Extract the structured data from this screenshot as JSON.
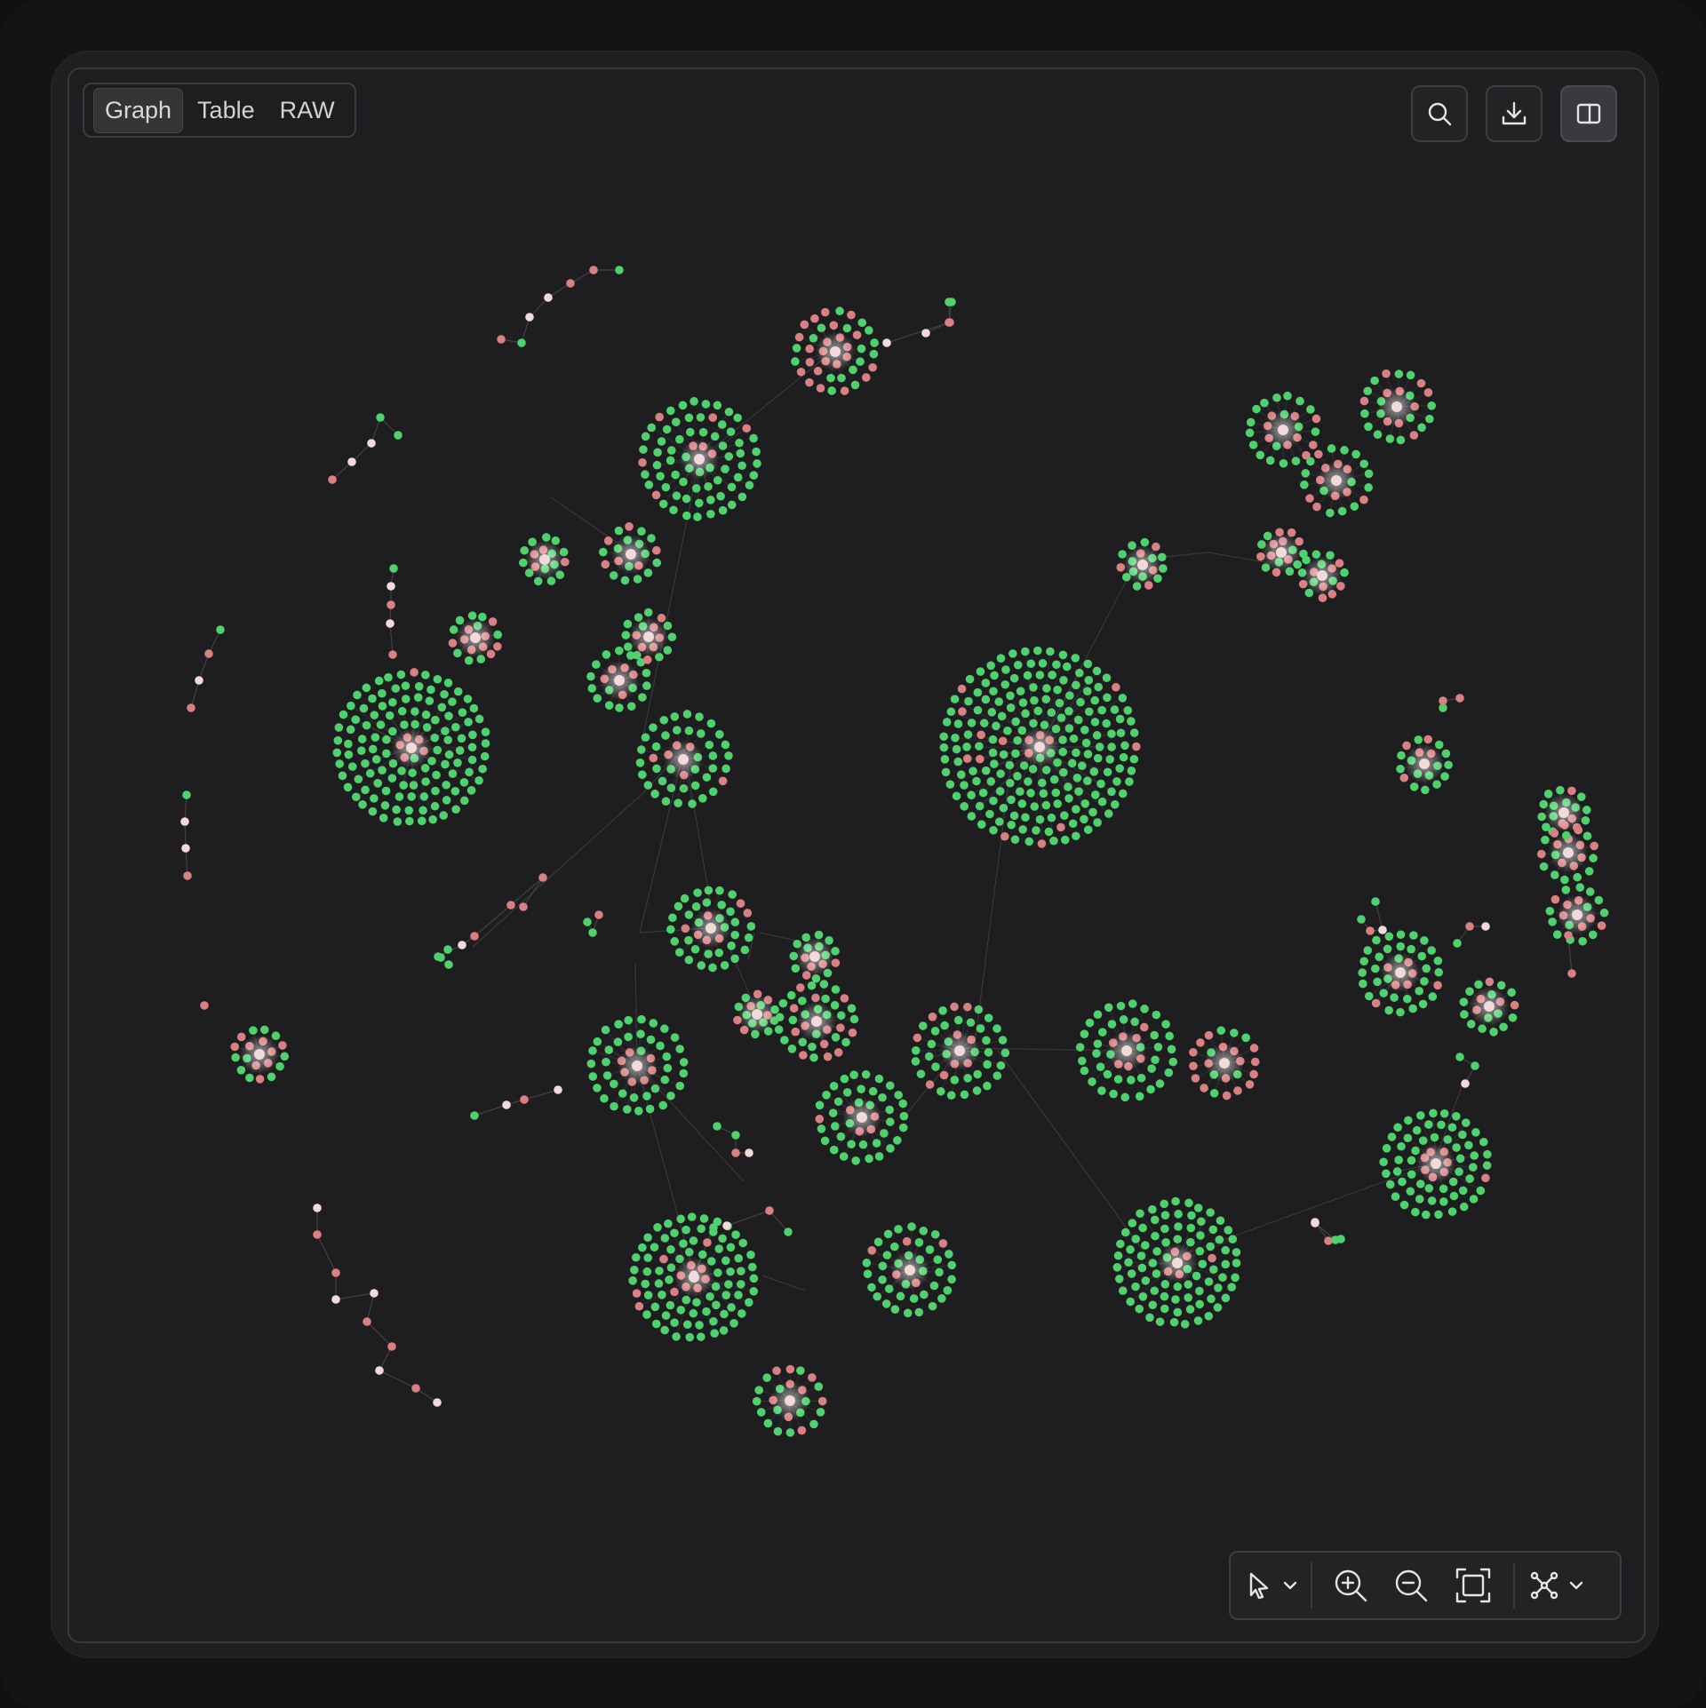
{
  "tabs": [
    {
      "label": "Graph",
      "active": true
    },
    {
      "label": "Table",
      "active": false
    },
    {
      "label": "RAW",
      "active": false
    }
  ],
  "top_actions": [
    "search-icon",
    "download-icon",
    "split-panel-icon"
  ],
  "toolbar": [
    "pointer-icon",
    "chevron-down-icon",
    "zoom-in-icon",
    "zoom-out-icon",
    "fit-screen-icon",
    "layout-graph-icon",
    "chevron-down-icon"
  ],
  "colors": {
    "node_primary": "#4fd16e",
    "node_secondary": "#d98083",
    "node_hub": "#f2d9da",
    "edge": "#4a4a4e"
  }
}
